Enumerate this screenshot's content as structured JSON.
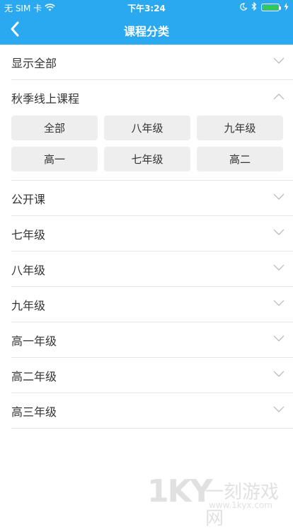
{
  "status_bar": {
    "carrier": "无 SIM 卡",
    "time": "下午3:24",
    "icons": [
      "wifi-icon",
      "moon-icon",
      "bluetooth-icon",
      "battery-icon",
      "charging-icon"
    ]
  },
  "nav": {
    "title": "课程分类",
    "back_icon": "chevron-left-icon"
  },
  "categories": [
    {
      "label": "显示全部",
      "expanded": false
    },
    {
      "label": "秋季线上课程",
      "expanded": true,
      "chips": [
        "全部",
        "八年级",
        "九年级",
        "高一",
        "七年级",
        "高二"
      ]
    },
    {
      "label": "公开课",
      "expanded": false
    },
    {
      "label": "七年级",
      "expanded": false
    },
    {
      "label": "八年级",
      "expanded": false
    },
    {
      "label": "九年级",
      "expanded": false
    },
    {
      "label": "高一年级",
      "expanded": false
    },
    {
      "label": "高二年级",
      "expanded": false
    },
    {
      "label": "高三年级",
      "expanded": false
    }
  ],
  "watermark": {
    "logo": "1KY",
    "text": "一刻游戏网",
    "url": "www.1kyx.com"
  },
  "colors": {
    "header": "#2aa9f0",
    "chip_bg": "#eeeeef",
    "battery": "#34c759"
  }
}
